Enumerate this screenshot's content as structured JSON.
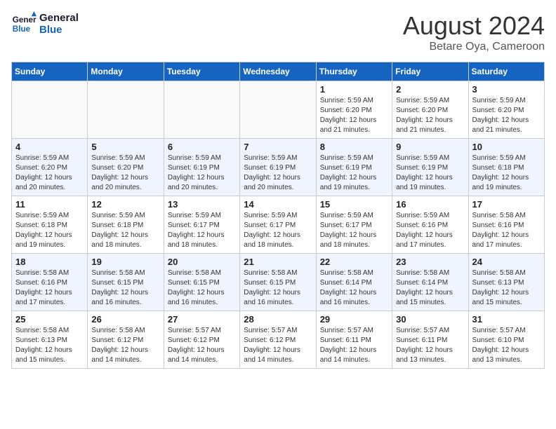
{
  "header": {
    "logo_line1": "General",
    "logo_line2": "Blue",
    "title": "August 2024",
    "subtitle": "Betare Oya, Cameroon"
  },
  "weekdays": [
    "Sunday",
    "Monday",
    "Tuesday",
    "Wednesday",
    "Thursday",
    "Friday",
    "Saturday"
  ],
  "weeks": [
    [
      {
        "day": "",
        "info": ""
      },
      {
        "day": "",
        "info": ""
      },
      {
        "day": "",
        "info": ""
      },
      {
        "day": "",
        "info": ""
      },
      {
        "day": "1",
        "info": "Sunrise: 5:59 AM\nSunset: 6:20 PM\nDaylight: 12 hours\nand 21 minutes."
      },
      {
        "day": "2",
        "info": "Sunrise: 5:59 AM\nSunset: 6:20 PM\nDaylight: 12 hours\nand 21 minutes."
      },
      {
        "day": "3",
        "info": "Sunrise: 5:59 AM\nSunset: 6:20 PM\nDaylight: 12 hours\nand 21 minutes."
      }
    ],
    [
      {
        "day": "4",
        "info": "Sunrise: 5:59 AM\nSunset: 6:20 PM\nDaylight: 12 hours\nand 20 minutes."
      },
      {
        "day": "5",
        "info": "Sunrise: 5:59 AM\nSunset: 6:20 PM\nDaylight: 12 hours\nand 20 minutes."
      },
      {
        "day": "6",
        "info": "Sunrise: 5:59 AM\nSunset: 6:19 PM\nDaylight: 12 hours\nand 20 minutes."
      },
      {
        "day": "7",
        "info": "Sunrise: 5:59 AM\nSunset: 6:19 PM\nDaylight: 12 hours\nand 20 minutes."
      },
      {
        "day": "8",
        "info": "Sunrise: 5:59 AM\nSunset: 6:19 PM\nDaylight: 12 hours\nand 19 minutes."
      },
      {
        "day": "9",
        "info": "Sunrise: 5:59 AM\nSunset: 6:19 PM\nDaylight: 12 hours\nand 19 minutes."
      },
      {
        "day": "10",
        "info": "Sunrise: 5:59 AM\nSunset: 6:18 PM\nDaylight: 12 hours\nand 19 minutes."
      }
    ],
    [
      {
        "day": "11",
        "info": "Sunrise: 5:59 AM\nSunset: 6:18 PM\nDaylight: 12 hours\nand 19 minutes."
      },
      {
        "day": "12",
        "info": "Sunrise: 5:59 AM\nSunset: 6:18 PM\nDaylight: 12 hours\nand 18 minutes."
      },
      {
        "day": "13",
        "info": "Sunrise: 5:59 AM\nSunset: 6:17 PM\nDaylight: 12 hours\nand 18 minutes."
      },
      {
        "day": "14",
        "info": "Sunrise: 5:59 AM\nSunset: 6:17 PM\nDaylight: 12 hours\nand 18 minutes."
      },
      {
        "day": "15",
        "info": "Sunrise: 5:59 AM\nSunset: 6:17 PM\nDaylight: 12 hours\nand 18 minutes."
      },
      {
        "day": "16",
        "info": "Sunrise: 5:59 AM\nSunset: 6:16 PM\nDaylight: 12 hours\nand 17 minutes."
      },
      {
        "day": "17",
        "info": "Sunrise: 5:58 AM\nSunset: 6:16 PM\nDaylight: 12 hours\nand 17 minutes."
      }
    ],
    [
      {
        "day": "18",
        "info": "Sunrise: 5:58 AM\nSunset: 6:16 PM\nDaylight: 12 hours\nand 17 minutes."
      },
      {
        "day": "19",
        "info": "Sunrise: 5:58 AM\nSunset: 6:15 PM\nDaylight: 12 hours\nand 16 minutes."
      },
      {
        "day": "20",
        "info": "Sunrise: 5:58 AM\nSunset: 6:15 PM\nDaylight: 12 hours\nand 16 minutes."
      },
      {
        "day": "21",
        "info": "Sunrise: 5:58 AM\nSunset: 6:15 PM\nDaylight: 12 hours\nand 16 minutes."
      },
      {
        "day": "22",
        "info": "Sunrise: 5:58 AM\nSunset: 6:14 PM\nDaylight: 12 hours\nand 16 minutes."
      },
      {
        "day": "23",
        "info": "Sunrise: 5:58 AM\nSunset: 6:14 PM\nDaylight: 12 hours\nand 15 minutes."
      },
      {
        "day": "24",
        "info": "Sunrise: 5:58 AM\nSunset: 6:13 PM\nDaylight: 12 hours\nand 15 minutes."
      }
    ],
    [
      {
        "day": "25",
        "info": "Sunrise: 5:58 AM\nSunset: 6:13 PM\nDaylight: 12 hours\nand 15 minutes."
      },
      {
        "day": "26",
        "info": "Sunrise: 5:58 AM\nSunset: 6:12 PM\nDaylight: 12 hours\nand 14 minutes."
      },
      {
        "day": "27",
        "info": "Sunrise: 5:57 AM\nSunset: 6:12 PM\nDaylight: 12 hours\nand 14 minutes."
      },
      {
        "day": "28",
        "info": "Sunrise: 5:57 AM\nSunset: 6:12 PM\nDaylight: 12 hours\nand 14 minutes."
      },
      {
        "day": "29",
        "info": "Sunrise: 5:57 AM\nSunset: 6:11 PM\nDaylight: 12 hours\nand 14 minutes."
      },
      {
        "day": "30",
        "info": "Sunrise: 5:57 AM\nSunset: 6:11 PM\nDaylight: 12 hours\nand 13 minutes."
      },
      {
        "day": "31",
        "info": "Sunrise: 5:57 AM\nSunset: 6:10 PM\nDaylight: 12 hours\nand 13 minutes."
      }
    ]
  ]
}
